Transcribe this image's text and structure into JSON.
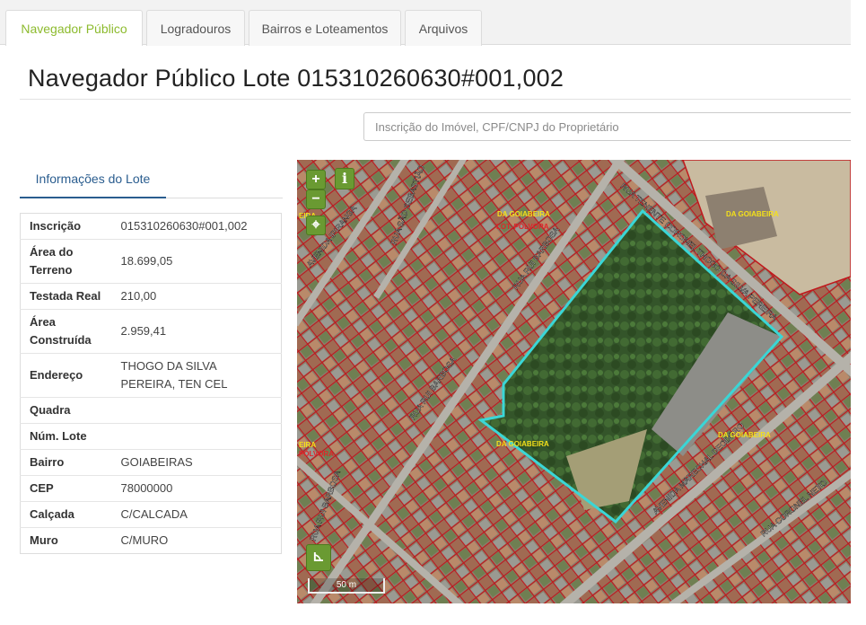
{
  "tabs": [
    {
      "label": "Navegador Público",
      "active": true
    },
    {
      "label": "Logradouros",
      "active": false
    },
    {
      "label": "Bairros e Loteamentos",
      "active": false
    },
    {
      "label": "Arquivos",
      "active": false
    }
  ],
  "page": {
    "title": "Navegador Público Lote 015310260630#001,002"
  },
  "search": {
    "placeholder": "Inscrição do Imóvel, CPF/CNPJ do Proprietário"
  },
  "info": {
    "tab_label": "Informações do Lote",
    "rows": [
      {
        "label": "Inscrição",
        "value": "015310260630#001,002"
      },
      {
        "label": "Área do Terreno",
        "value": "18.699,05"
      },
      {
        "label": "Testada Real",
        "value": "210,00"
      },
      {
        "label": "Área Construída",
        "value": "2.959,41"
      },
      {
        "label": "Endereço",
        "value": "THOGO DA SILVA PEREIRA, TEN CEL"
      },
      {
        "label": "Quadra",
        "value": ""
      },
      {
        "label": "Núm. Lote",
        "value": ""
      },
      {
        "label": "Bairro",
        "value": "GOIABEIRAS"
      },
      {
        "label": "CEP",
        "value": "78000000"
      },
      {
        "label": "Calçada",
        "value": "C/CALCADA"
      },
      {
        "label": "Muro",
        "value": "C/MURO"
      }
    ]
  },
  "map": {
    "zoom_in": "+",
    "zoom_out": "−",
    "info_button": "i",
    "scale_label": "50 m",
    "labels": [
      "RUA TENENTE CORONEL THOGO DA SILVA PEREIRA",
      "AVENIDA MARECHAL DEODORO",
      "RUA RUI BARBOSA",
      "RUA RUI BARBOSA",
      "RUA RUI BARBOSA",
      "AVENIDA IPIRANGA",
      "RUA CORONEL NETO",
      "RUA SÃO SEBASTIÃO",
      "DA GOIABEIRA",
      "DA GOIABEIRA",
      "DA GOIABEIRA",
      "DA GOIABEIRA",
      "LOT. PÓLVORA",
      "EIRA",
      "EIRA",
      "PÓLVORA"
    ],
    "colors": {
      "parcel": "#c0181c",
      "selected": "#3ad6d6",
      "button": "#6a9a32"
    }
  },
  "colors": {
    "accent_tab": "#8dbb2e",
    "info_tab": "#2a5d8f"
  }
}
